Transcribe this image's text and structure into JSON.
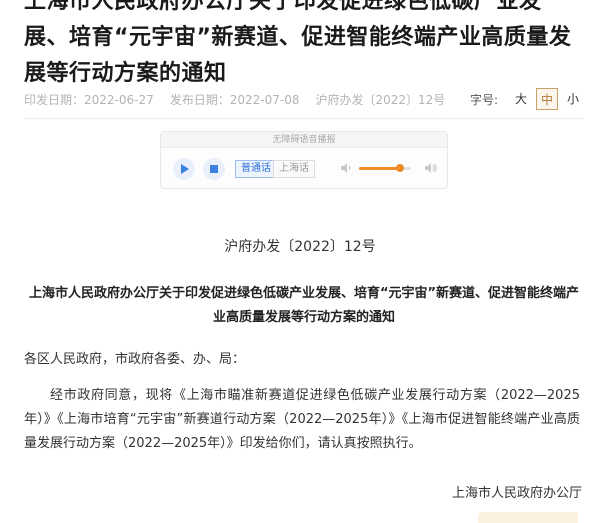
{
  "article": {
    "title": "上海市人民政府办公厅关于印发促进绿色低碳产业发展、培育“元宇宙”新赛道、促进智能终端产业高质量发展等行动方案的通知",
    "print_date": "印发日期：2022-06-27",
    "publish_date": "发布日期：2022-07-08",
    "doc_number": "沪府办发〔2022〕12号"
  },
  "font_size": {
    "label": "字号:",
    "options": [
      "大",
      "中",
      "小"
    ],
    "selected": "中"
  },
  "audio_player": {
    "header": "无障碍语音播报",
    "languages": [
      "普通话",
      "上海话"
    ],
    "selected_language": "普通话",
    "volume": 0.78,
    "accent_color": "#3b82e0",
    "volume_color": "#f08a24"
  },
  "document": {
    "number": "沪府办发〔2022〕12号",
    "title": "上海市人民政府办公厅关于印发促进绿色低碳产业发展、培育“元宇宙”新赛道、促进智能终端产业高质量发展等行动方案的通知",
    "salutation": "各区人民政府，市政府各委、办、局：",
    "body": "经市政府同意，现将《上海市瞄准新赛道促进绿色低碳产业发展行动方案（2022—2025年）》《上海市培育“元宇宙”新赛道行动方案（2022—2025年）》《上海市促进智能终端产业高质量发展行动方案（2022—2025年）》印发给你们，请认真按照执行。",
    "signature": "上海市人民政府办公厅"
  }
}
